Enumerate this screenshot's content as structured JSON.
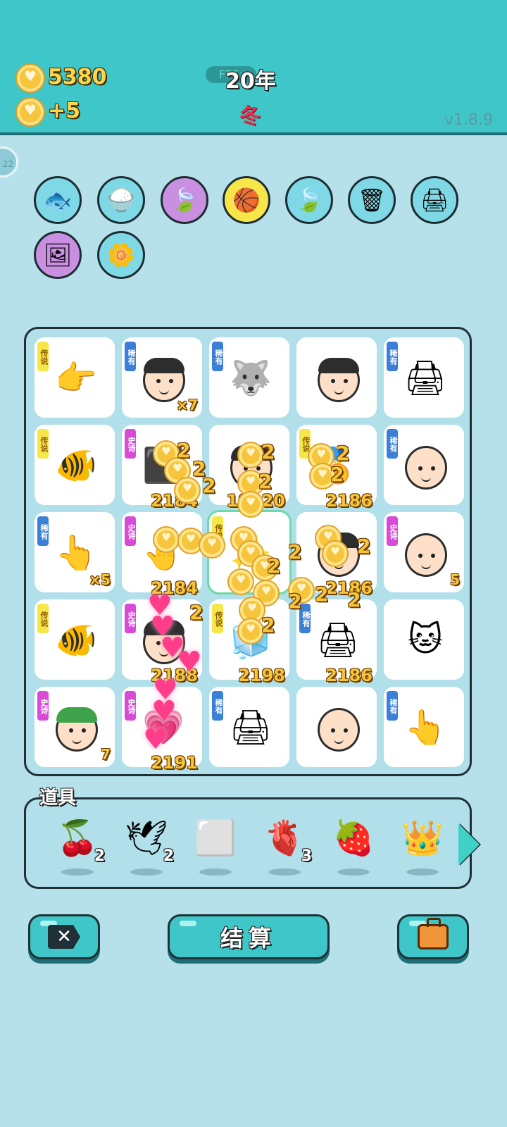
{
  "header": {
    "coins": "5380",
    "income": "+5",
    "fps_label": "FPS:",
    "year": "20年",
    "season": "冬",
    "version": "v1.8.9"
  },
  "side_badge": "22",
  "status_icons": [
    {
      "name": "fishbowl-icon",
      "glyph": "🐟",
      "bg": "#7fd8e5"
    },
    {
      "name": "rice-bowl-icon",
      "glyph": "🍚",
      "bg": "#7fd8e5"
    },
    {
      "name": "leaf-icon",
      "glyph": "🍃",
      "bg": "#c98fe0"
    },
    {
      "name": "basketballs-icon",
      "glyph": "🏀",
      "bg": "#f7e64a"
    },
    {
      "name": "leaf-icon",
      "glyph": "🍃",
      "bg": "#7fd8e5"
    },
    {
      "name": "trash-bag-icon",
      "glyph": "🗑",
      "bg": "#7fd8e5"
    },
    {
      "name": "printer-icon",
      "glyph": "🖨",
      "bg": "#7fd8e5"
    },
    {
      "name": "photo-frame-icon",
      "glyph": "🖼",
      "bg": "#c98fe0"
    },
    {
      "name": "flower-pot-icon",
      "glyph": "🌼",
      "bg": "#7fd8e5"
    }
  ],
  "tags": {
    "legend": "传说",
    "epic": "史诗",
    "rare": "稀有"
  },
  "board": [
    [
      {
        "tag": "legend",
        "item": "pointing-hand",
        "glyph": "👉"
      },
      {
        "tag": "rare",
        "item": "police-officer",
        "glyph": "face",
        "count": "×7"
      },
      {
        "tag": "rare",
        "item": "husky-dog",
        "glyph": "🐺"
      },
      {
        "tag": "",
        "item": "man-face",
        "glyph": "face"
      },
      {
        "tag": "rare",
        "item": "printer",
        "glyph": "🖨"
      }
    ],
    [
      {
        "tag": "legend",
        "item": "koi-fish",
        "glyph": "🐠"
      },
      {
        "tag": "epic",
        "item": "gray-item",
        "glyph": "⬛",
        "value": "2184"
      },
      {
        "tag": "",
        "item": "man-face",
        "glyph": "face",
        "value": "10920"
      },
      {
        "tag": "legend",
        "item": "gold-item",
        "glyph": "🏅",
        "value": "2186"
      },
      {
        "tag": "rare",
        "item": "bald-man",
        "glyph": "face"
      }
    ],
    [
      {
        "tag": "rare",
        "item": "pointing-hand-brown",
        "glyph": "👆",
        "count": "×5"
      },
      {
        "tag": "epic",
        "item": "gray-hand",
        "glyph": "🤚",
        "value": "2184"
      },
      {
        "tag": "legend",
        "item": "selected-cell",
        "glyph": "✨"
      },
      {
        "tag": "",
        "item": "man-glasses",
        "glyph": "face",
        "value": "2186"
      },
      {
        "tag": "epic",
        "item": "old-man",
        "glyph": "face",
        "count": "5"
      }
    ],
    [
      {
        "tag": "legend",
        "item": "koi-fish",
        "glyph": "🐠"
      },
      {
        "tag": "epic",
        "item": "heart-face",
        "glyph": "face",
        "value": "2188"
      },
      {
        "tag": "legend",
        "item": "fridge",
        "glyph": "🧊",
        "value": "2198"
      },
      {
        "tag": "rare",
        "item": "printer",
        "glyph": "🖨",
        "value": "2186"
      },
      {
        "tag": "",
        "item": "cat",
        "glyph": "🐱"
      }
    ],
    [
      {
        "tag": "epic",
        "item": "green-hair-face",
        "glyph": "face",
        "count": "7"
      },
      {
        "tag": "epic",
        "item": "heart-burst",
        "glyph": "💗",
        "value": "2191"
      },
      {
        "tag": "rare",
        "item": "printer",
        "glyph": "🖨"
      },
      {
        "tag": "",
        "item": "glasses-man",
        "glyph": "face"
      },
      {
        "tag": "rare",
        "item": "pointing-hand-brown",
        "glyph": "👆"
      }
    ]
  ],
  "fx_value": "2",
  "tools": {
    "title": "道具",
    "items": [
      {
        "name": "lychee-icon",
        "glyph": "🍒",
        "count": "2"
      },
      {
        "name": "dove-icon",
        "glyph": "🕊",
        "count": "2"
      },
      {
        "name": "frame-icon",
        "glyph": "⬜",
        "count": ""
      },
      {
        "name": "liver-icon",
        "glyph": "🫀",
        "count": "3"
      },
      {
        "name": "strawberry-icon",
        "glyph": "🍓",
        "count": ""
      },
      {
        "name": "crown-icon",
        "glyph": "👑",
        "count": ""
      }
    ]
  },
  "buttons": {
    "exit": "✕",
    "settle": "结算"
  }
}
